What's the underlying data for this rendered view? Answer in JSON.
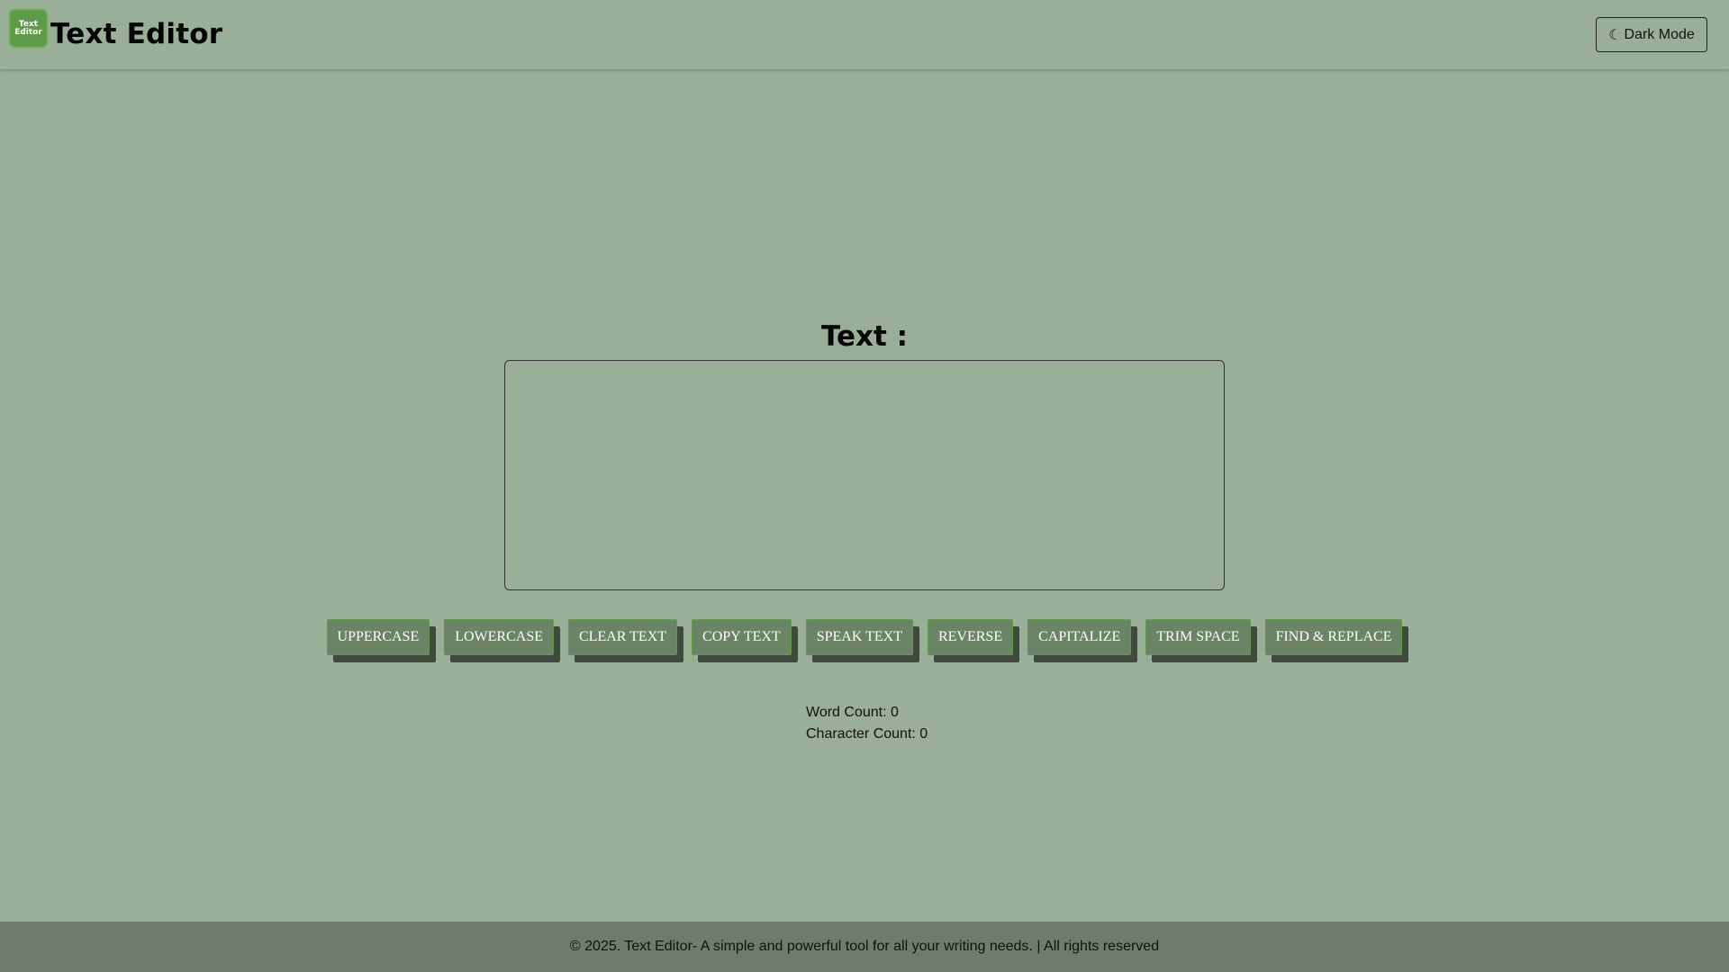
{
  "header": {
    "logo_line1": "Text",
    "logo_line2": "Editor",
    "brand": "Text Editor",
    "dark_mode_icon": "☾",
    "dark_mode_label": "Dark Mode"
  },
  "main": {
    "heading": "Text :",
    "textarea_value": "",
    "buttons": [
      "UPPERCASE",
      "LOWERCASE",
      "CLEAR TEXT",
      "COPY TEXT",
      "SPEAK TEXT",
      "REVERSE",
      "CAPITALIZE",
      "TRIM SPACE",
      "FIND & REPLACE"
    ],
    "word_count_label": "Word Count: 0",
    "char_count_label": "Character Count: 0"
  },
  "footer": {
    "text": "© 2025. Text Editor- A simple and powerful tool for all your writing needs. | All rights reserved"
  },
  "colors": {
    "background": "#9aaf97",
    "button_bg": "#6b8466",
    "button_border": "#5d9b45",
    "footer_bg": "#6e7c6c",
    "logo_bg": "#5e9a4a"
  },
  "icons": {
    "logo": "text-editor-logo-icon",
    "dark_mode": "moon-icon"
  }
}
